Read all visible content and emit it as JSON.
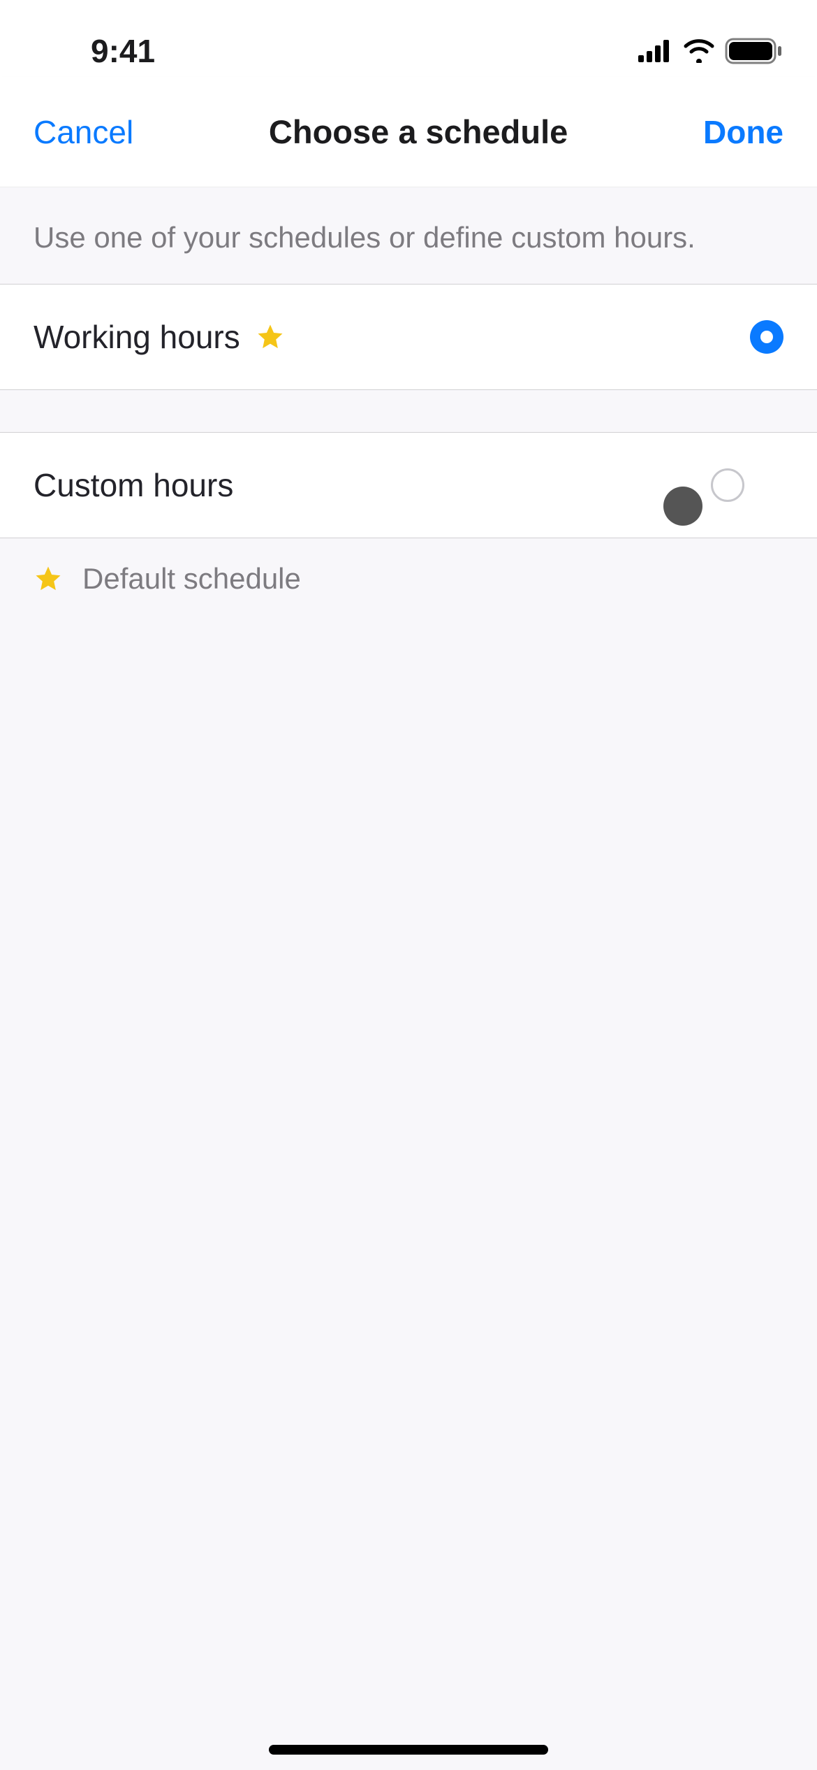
{
  "status": {
    "time": "9:41"
  },
  "nav": {
    "cancel": "Cancel",
    "title": "Choose a schedule",
    "done": "Done"
  },
  "sectionHint": "Use one of your schedules or define custom hours.",
  "options": {
    "working": {
      "label": "Working hours"
    },
    "custom": {
      "label": "Custom hours"
    }
  },
  "legend": {
    "default": "Default schedule"
  }
}
